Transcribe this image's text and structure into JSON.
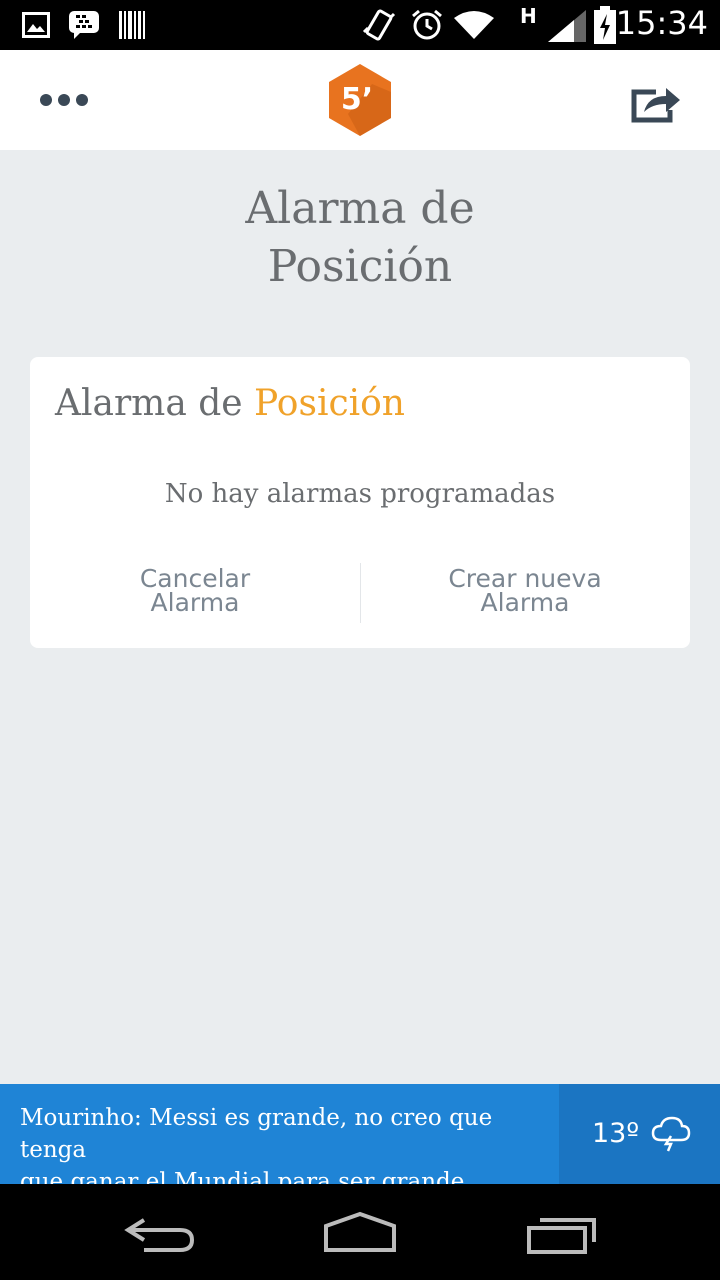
{
  "status_bar": {
    "time": "15:34",
    "network": "H",
    "icons": [
      "image-icon",
      "bbm-icon",
      "barcode-icon",
      "vibrate-icon",
      "alarm-icon",
      "wifi-icon",
      "signal-icon",
      "battery-icon"
    ]
  },
  "app_bar": {
    "logo_text": "5’",
    "logo_color": "#e8731f",
    "icons": [
      "more-icon",
      "share-icon"
    ]
  },
  "page": {
    "title_line1": "Alarma de",
    "title_line2": "Posición"
  },
  "card": {
    "title_prefix": "Alarma de ",
    "title_accent": "Posición",
    "accent_color": "#f0a22a",
    "empty_message": "No hay alarmas programadas",
    "cancel_line1": "Cancelar",
    "cancel_line2": "Alarma",
    "create_line1": "Crear nueva",
    "create_line2": "Alarma"
  },
  "ticker": {
    "headline_line1": "Mourinho: Messi es grande, no creo que tenga",
    "headline_line2": "que ganar el Mundial para ser grande",
    "temperature": "13º",
    "weather_icon": "storm-cloud-icon"
  },
  "nav_bar": {
    "buttons": [
      "back-icon",
      "home-icon",
      "recents-icon"
    ]
  }
}
